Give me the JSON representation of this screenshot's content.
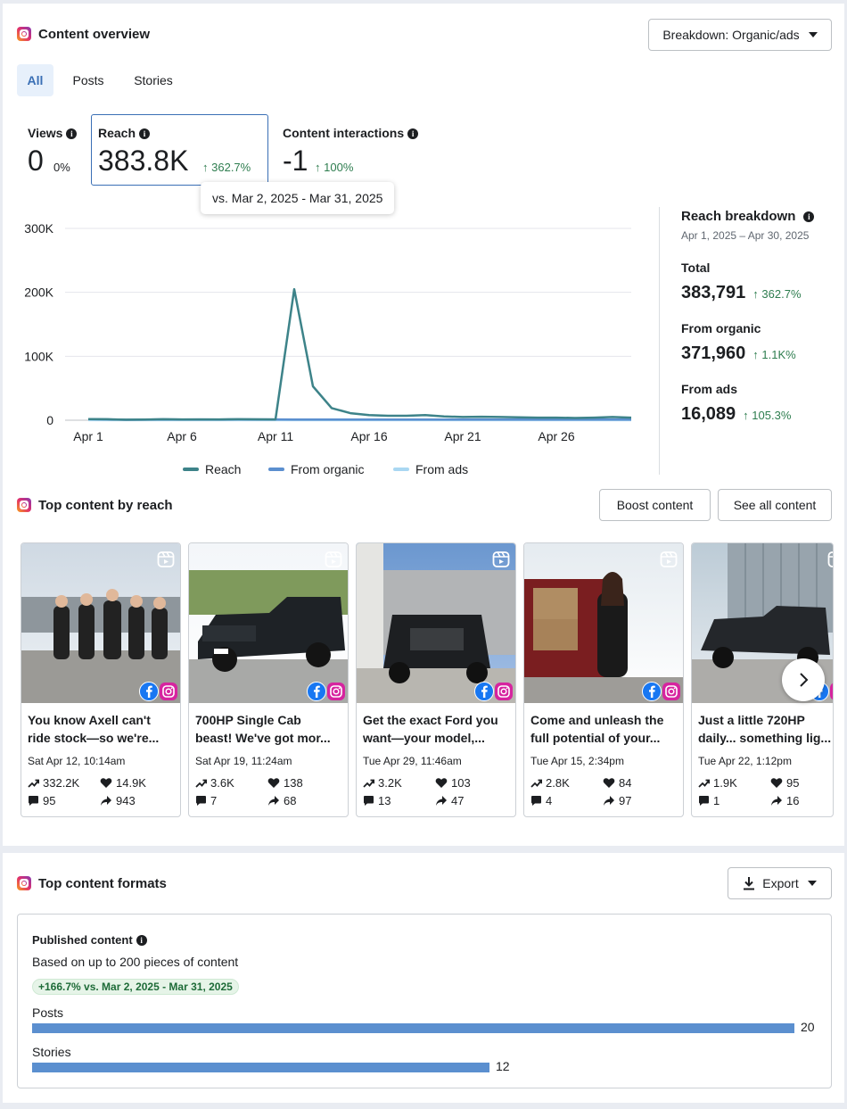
{
  "overview": {
    "title": "Content overview",
    "breakdown_button": "Breakdown: Organic/ads",
    "tabs": [
      {
        "label": "All",
        "active": true
      },
      {
        "label": "Posts",
        "active": false
      },
      {
        "label": "Stories",
        "active": false
      }
    ],
    "metrics": [
      {
        "label": "Views",
        "value": "0",
        "change": "0%",
        "trend": "none"
      },
      {
        "label": "Reach",
        "value": "383.8K",
        "change": "362.7%",
        "trend": "up"
      },
      {
        "label": "Content interactions",
        "value": "-1",
        "change": "100%",
        "trend": "up"
      }
    ],
    "tooltip": "vs. Mar 2, 2025 - Mar 31, 2025"
  },
  "chart_data": {
    "type": "line",
    "title": "",
    "xlabel": "",
    "ylabel": "",
    "x_ticks": [
      "Apr 1",
      "Apr 6",
      "Apr 11",
      "Apr 16",
      "Apr 21",
      "Apr 26"
    ],
    "y_ticks": [
      "0",
      "100K",
      "200K",
      "300K"
    ],
    "ylim": [
      0,
      300000
    ],
    "xlim": [
      1,
      30
    ],
    "grid": true,
    "legend_position": "bottom",
    "x": [
      1,
      2,
      3,
      4,
      5,
      6,
      7,
      8,
      9,
      10,
      11,
      12,
      13,
      14,
      15,
      16,
      17,
      18,
      19,
      20,
      21,
      22,
      23,
      24,
      25,
      26,
      27,
      28,
      29,
      30
    ],
    "series": [
      {
        "name": "Reach",
        "color": "#3d8389",
        "values": [
          1800,
          1500,
          800,
          1000,
          1500,
          1200,
          1300,
          1200,
          1500,
          1400,
          1300,
          205000,
          53000,
          19000,
          11000,
          8000,
          7000,
          7000,
          8000,
          6000,
          5000,
          5500,
          5000,
          4500,
          4000,
          4000,
          3500,
          4000,
          5000,
          4000
        ]
      },
      {
        "name": "From organic",
        "color": "#5b8fcf",
        "values": [
          1700,
          1400,
          700,
          900,
          1400,
          1100,
          1200,
          1100,
          1400,
          1300,
          1200,
          1000,
          1000,
          1000,
          1000,
          1000,
          1000,
          1000,
          1000,
          1000,
          1000,
          1000,
          1000,
          1000,
          1000,
          1000,
          1000,
          1000,
          1000,
          1000
        ]
      },
      {
        "name": "From ads",
        "color": "#a9d7f2",
        "values": [
          100,
          100,
          100,
          100,
          100,
          100,
          100,
          100,
          100,
          100,
          100,
          100,
          100,
          100,
          100,
          100,
          100,
          100,
          100,
          100,
          100,
          100,
          100,
          100,
          100,
          100,
          100,
          100,
          100,
          100
        ]
      }
    ]
  },
  "reach_breakdown": {
    "title": "Reach breakdown",
    "date_range": "Apr 1, 2025 – Apr 30, 2025",
    "items": [
      {
        "label": "Total",
        "value": "383,791",
        "change": "362.7%"
      },
      {
        "label": "From organic",
        "value": "371,960",
        "change": "1.1K%"
      },
      {
        "label": "From ads",
        "value": "16,089",
        "change": "105.3%"
      }
    ]
  },
  "top_content": {
    "title": "Top content by reach",
    "boost_button": "Boost content",
    "see_all_button": "See all content",
    "tiles": [
      {
        "caption1": "You know Axell can't",
        "caption2": "ride stock—so we're...",
        "date": "Sat Apr 12, 10:14am",
        "reach": "332.2K",
        "likes": "14.9K",
        "comments": "95",
        "shares": "943"
      },
      {
        "caption1": "700HP Single Cab",
        "caption2": "beast! We've got mor...",
        "date": "Sat Apr 19, 11:24am",
        "reach": "3.6K",
        "likes": "138",
        "comments": "7",
        "shares": "68"
      },
      {
        "caption1": "Get the exact Ford you",
        "caption2": "want—your model,...",
        "date": "Tue Apr 29, 11:46am",
        "reach": "3.2K",
        "likes": "103",
        "comments": "13",
        "shares": "47"
      },
      {
        "caption1": "Come and unleash the",
        "caption2": "full potential of your...",
        "date": "Tue Apr 15, 2:34pm",
        "reach": "2.8K",
        "likes": "84",
        "comments": "4",
        "shares": "97"
      },
      {
        "caption1": "Just a little 720HP",
        "caption2": "daily... something lig...",
        "date": "Tue Apr 22, 1:12pm",
        "reach": "1.9K",
        "likes": "95",
        "comments": "1",
        "shares": "16"
      }
    ]
  },
  "formats": {
    "title": "Top content formats",
    "export_button": "Export",
    "published_title": "Published content",
    "subtitle": "Based on up to 200 pieces of content",
    "comparison_pill": "+166.7% vs. Mar 2, 2025 - Mar 31, 2025",
    "bars": [
      {
        "label": "Posts",
        "value": 20
      },
      {
        "label": "Stories",
        "value": 12
      }
    ],
    "bar_max": 20
  }
}
